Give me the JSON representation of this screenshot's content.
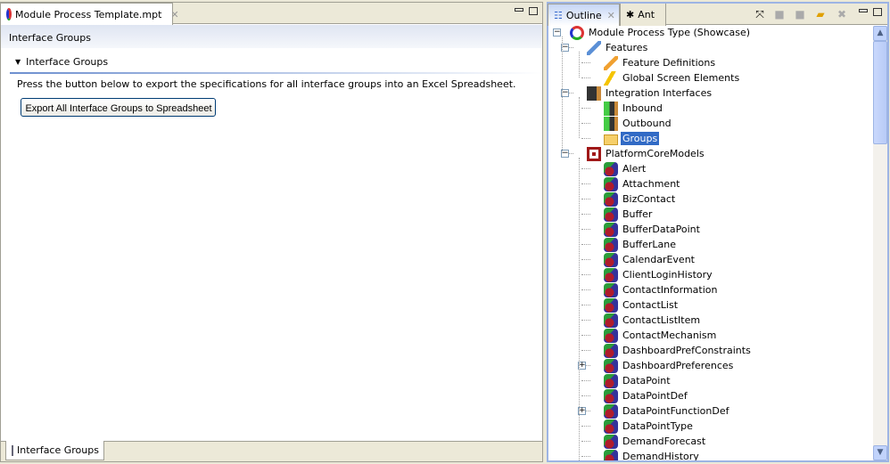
{
  "editor": {
    "tab_title": "Module Process Template.mpt",
    "header": "Interface Groups",
    "section_title": "Interface Groups",
    "description": "Press the button below to export the specifications for all interface groups into an Excel Spreadsheet.",
    "export_button": "Export All Interface Groups to Spreadsheet",
    "bottom_tab": "Interface Groups"
  },
  "outline": {
    "tabs": [
      {
        "label": "Outline",
        "active": true
      },
      {
        "label": "Ant",
        "active": false
      }
    ],
    "toolbar": [
      "collapse-all-icon",
      "disabled-action-icon",
      "disabled-action-icon",
      "export-folder-icon",
      "delete-icon"
    ],
    "selection_color": "#316ac5",
    "tree": [
      {
        "label": "Module Process Type (Showcase)",
        "level": 0,
        "expander": "minus",
        "icon": "module-icon"
      },
      {
        "label": "Features",
        "level": 1,
        "expander": "minus",
        "icon": "wrench-icon"
      },
      {
        "label": "Feature Definitions",
        "level": 2,
        "icon": "wrench-orange-icon"
      },
      {
        "label": "Global Screen Elements",
        "level": 2,
        "icon": "lightning-icon"
      },
      {
        "label": "Integration Interfaces",
        "level": 1,
        "expander": "minus",
        "icon": "door-icon"
      },
      {
        "label": "Inbound",
        "level": 2,
        "icon": "door-in-icon"
      },
      {
        "label": "Outbound",
        "level": 2,
        "icon": "door-out-icon"
      },
      {
        "label": "Groups",
        "level": 2,
        "icon": "folder-arrow-icon",
        "selected": true
      },
      {
        "label": "PlatformCoreModels",
        "level": 1,
        "expander": "minus",
        "icon": "models-icon"
      },
      {
        "label": "Alert",
        "level": 2,
        "icon": "entity-icon"
      },
      {
        "label": "Attachment",
        "level": 2,
        "icon": "entity-icon"
      },
      {
        "label": "BizContact",
        "level": 2,
        "icon": "entity-icon"
      },
      {
        "label": "Buffer",
        "level": 2,
        "icon": "entity-icon"
      },
      {
        "label": "BufferDataPoint",
        "level": 2,
        "icon": "entity-icon"
      },
      {
        "label": "BufferLane",
        "level": 2,
        "icon": "entity-icon"
      },
      {
        "label": "CalendarEvent",
        "level": 2,
        "icon": "entity-icon"
      },
      {
        "label": "ClientLoginHistory",
        "level": 2,
        "icon": "entity-icon"
      },
      {
        "label": "ContactInformation",
        "level": 2,
        "icon": "entity-icon"
      },
      {
        "label": "ContactList",
        "level": 2,
        "icon": "entity-icon"
      },
      {
        "label": "ContactListItem",
        "level": 2,
        "icon": "entity-icon"
      },
      {
        "label": "ContactMechanism",
        "level": 2,
        "icon": "entity-icon"
      },
      {
        "label": "DashboardPrefConstraints",
        "level": 2,
        "icon": "entity-icon"
      },
      {
        "label": "DashboardPreferences",
        "level": 2,
        "expander": "plus",
        "icon": "entity-icon"
      },
      {
        "label": "DataPoint",
        "level": 2,
        "icon": "entity-icon"
      },
      {
        "label": "DataPointDef",
        "level": 2,
        "icon": "entity-icon"
      },
      {
        "label": "DataPointFunctionDef",
        "level": 2,
        "expander": "plus",
        "icon": "entity-icon"
      },
      {
        "label": "DataPointType",
        "level": 2,
        "icon": "entity-icon"
      },
      {
        "label": "DemandForecast",
        "level": 2,
        "icon": "entity-icon"
      },
      {
        "label": "DemandHistory",
        "level": 2,
        "icon": "entity-icon"
      }
    ]
  }
}
